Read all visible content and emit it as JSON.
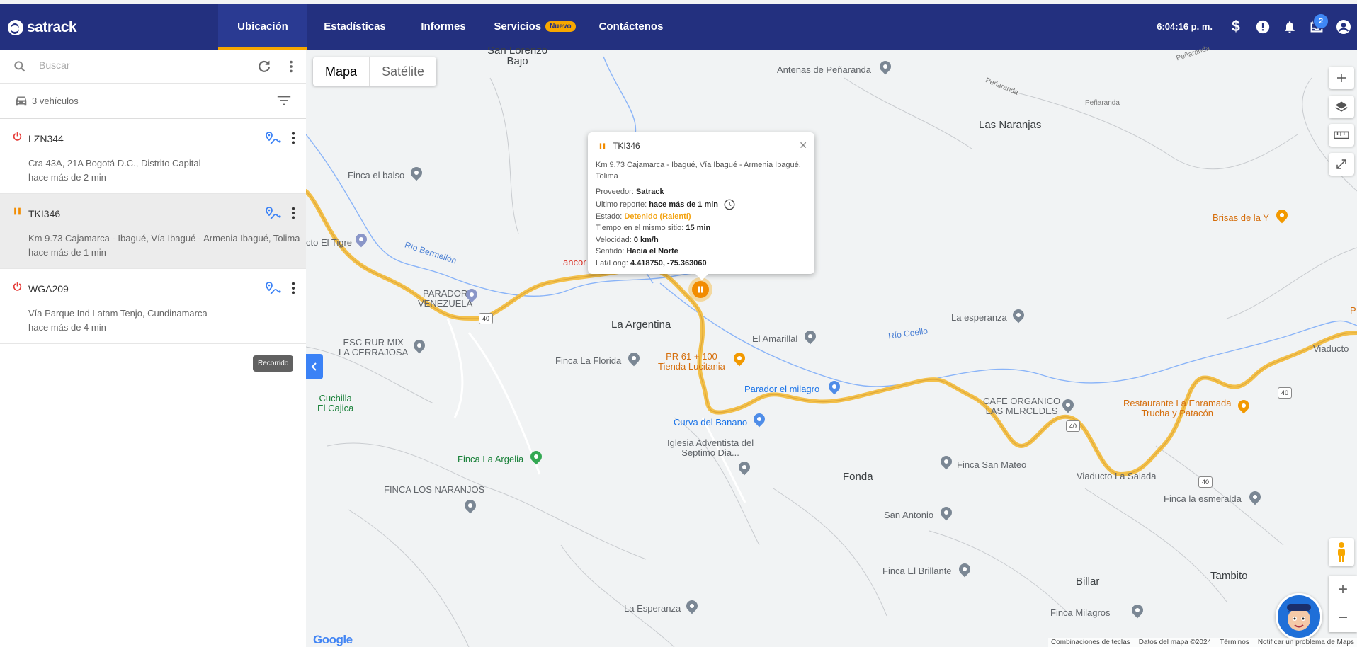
{
  "brand": {
    "name": "satrack"
  },
  "nav": {
    "items": [
      {
        "label": "Ubicación"
      },
      {
        "label": "Estadísticas"
      },
      {
        "label": "Informes"
      },
      {
        "label": "Servicios"
      },
      {
        "label": "Contáctenos"
      }
    ],
    "new_badge": "Nuevo",
    "active_index": 0
  },
  "topbar": {
    "time": "6:04:16 p. m.",
    "inbox_count": "2"
  },
  "sidebar": {
    "search_placeholder": "Buscar",
    "vehicle_count": "3 vehículos",
    "vehicles": [
      {
        "plate": "LZN344",
        "address": "Cra 43A, 21A Bogotá D.C., Distrito Capital",
        "time": "hace más de 2 min",
        "status": "off"
      },
      {
        "plate": "TKI346",
        "address": "Km 9.73 Cajamarca - Ibagué, Vía Ibagué - Armenia Ibagué, Tolima",
        "time": "hace más de 1 min",
        "status": "paused"
      },
      {
        "plate": "WGA209",
        "address": "Vía Parque Ind Latam Tenjo, Cundinamarca",
        "time": "hace más de 4 min",
        "status": "off"
      }
    ],
    "tooltip": "Recorrido"
  },
  "map": {
    "type_tabs": [
      "Mapa",
      "Satélite"
    ],
    "labels": {
      "san_lorenzo": "San Lorenzo\nBajo",
      "antenas": "Antenas de Peñaranda",
      "penaranda1": "Peñaranda",
      "penaranda2": "Peñaranda",
      "penaranda3": "Peñaranda",
      "las_naranjas": "Las Naranjas",
      "finca_balso": "Finca el balso",
      "brisas": "Brisas de la Y",
      "el_tigre": "cto El Tigre",
      "rio_bermellon": "Río Bermellón",
      "ancor": "ancor",
      "parador_venezuela": "PARADOR\nVENEZUELA",
      "la_argentina": "La Argentina",
      "la_esperanza1": "La esperanza",
      "el_amarillal": "El Amarillal",
      "rio_coello": "Río Coello",
      "esc_rur": "ESC RUR MIX\nLA CERRAJOSA",
      "finca_florida": "Finca La Florida",
      "pr61": "PR 61 + 100\nTienda Lucitania",
      "viaducto": "Viaducto",
      "parador_milagro": "Parador el milagro",
      "cuchilla": "Cuchilla\nEl Cajica",
      "curva_banano": "Curva del Banano",
      "cafe_organico": "CAFE ORGANICO\nLAS MERCEDES",
      "restaurante": "Restaurante La Enramada\nTrucha y Patacón",
      "iglesia": "Iglesia Adventista del\nSeptimo Dia...",
      "finca_argelia": "Finca La Argelia",
      "fonda": "Fonda",
      "finca_san_mateo": "Finca San Mateo",
      "viaducto_salada": "Viaducto La Salada",
      "finca_naranjos": "FINCA LOS NARANJOS",
      "finca_esmeralda": "Finca la esmeralda",
      "san_antonio": "San Antonio",
      "finca_brillante": "Finca El Brillante",
      "billar": "Billar",
      "tambito": "Tambito",
      "la_esperanza2": "La Esperanza",
      "finca_milagros": "Finca Milagros",
      "road40": "40",
      "partial_p": "P"
    },
    "footer": [
      "Combinaciones de teclas",
      "Datos del mapa ©2024",
      "Términos",
      "Notificar un problema de Maps"
    ],
    "google": "Google"
  },
  "popup": {
    "plate": "TKI346",
    "address": "Km 9.73 Cajamarca - Ibagué, Vía Ibagué - Armenia Ibagué, Tolima",
    "rows": [
      {
        "label": "Proveedor:",
        "value": "Satrack"
      },
      {
        "label": "Último reporte:",
        "value": "hace más de 1 min"
      },
      {
        "label": "Estado:",
        "value": "Detenido (Ralentí)"
      },
      {
        "label": "Tiempo en el mismo sitio:",
        "value": "15 min"
      },
      {
        "label": "Velocidad:",
        "value": "0 km/h"
      },
      {
        "label": "Sentido:",
        "value": "Hacia el Norte"
      },
      {
        "label": "Lat/Long:",
        "value": "4.418750, -75.363060"
      }
    ]
  },
  "colors": {
    "topbar": "#23307f",
    "accent": "#f7a700",
    "status_off": "#e53935",
    "status_paused": "#f28c00",
    "link": "#3b82f6"
  }
}
